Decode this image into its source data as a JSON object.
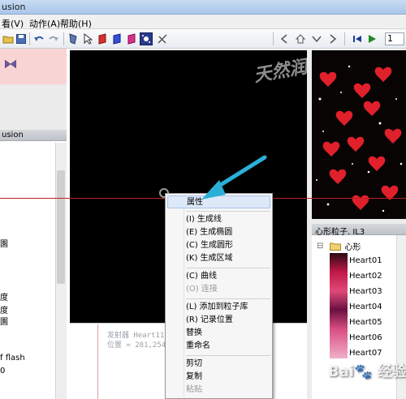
{
  "window": {
    "title": "usion"
  },
  "menu": {
    "view": "看(V)",
    "action": "动作(A)",
    "help": "帮助(H)"
  },
  "toolbar": {
    "frame_value": "1"
  },
  "left_panel": {
    "header": "usion",
    "labels": [
      "園",
      "度",
      "度",
      "園",
      "f flash",
      "0"
    ]
  },
  "canvas": {
    "emitter_label": "发射器  Heart11",
    "position_label": "位置 = 281,254"
  },
  "context_menu": {
    "items": [
      {
        "label": "属性",
        "highlighted": true
      },
      {
        "label": "(I) 生成线"
      },
      {
        "label": "(E) 生成椭圆"
      },
      {
        "label": "(C) 生成圆形"
      },
      {
        "label": "(K) 生成区域"
      },
      {
        "label": "(C) 曲线"
      },
      {
        "label": "(O) 连接",
        "disabled": true
      },
      {
        "label": "(L) 添加到粒子库"
      },
      {
        "label": "(R) 记录位置"
      },
      {
        "label": "替换"
      },
      {
        "label": "重命名"
      },
      {
        "label": "剪切"
      },
      {
        "label": "复制"
      },
      {
        "label": "粘贴",
        "disabled": true
      }
    ]
  },
  "particles_panel": {
    "title": "心形粒子. IL3",
    "folder": "心形",
    "expander": "⊟",
    "items": [
      "Heart01",
      "Heart02",
      "Heart03",
      "Heart04",
      "Heart05",
      "Heart06",
      "Heart07"
    ]
  },
  "watermark": "天然润",
  "baidu_mark": "Bai🐾 经验",
  "colors": {
    "accent_arrow": "#2ab0d8",
    "canvas": "#000000",
    "highlight": "#dde8f8"
  }
}
